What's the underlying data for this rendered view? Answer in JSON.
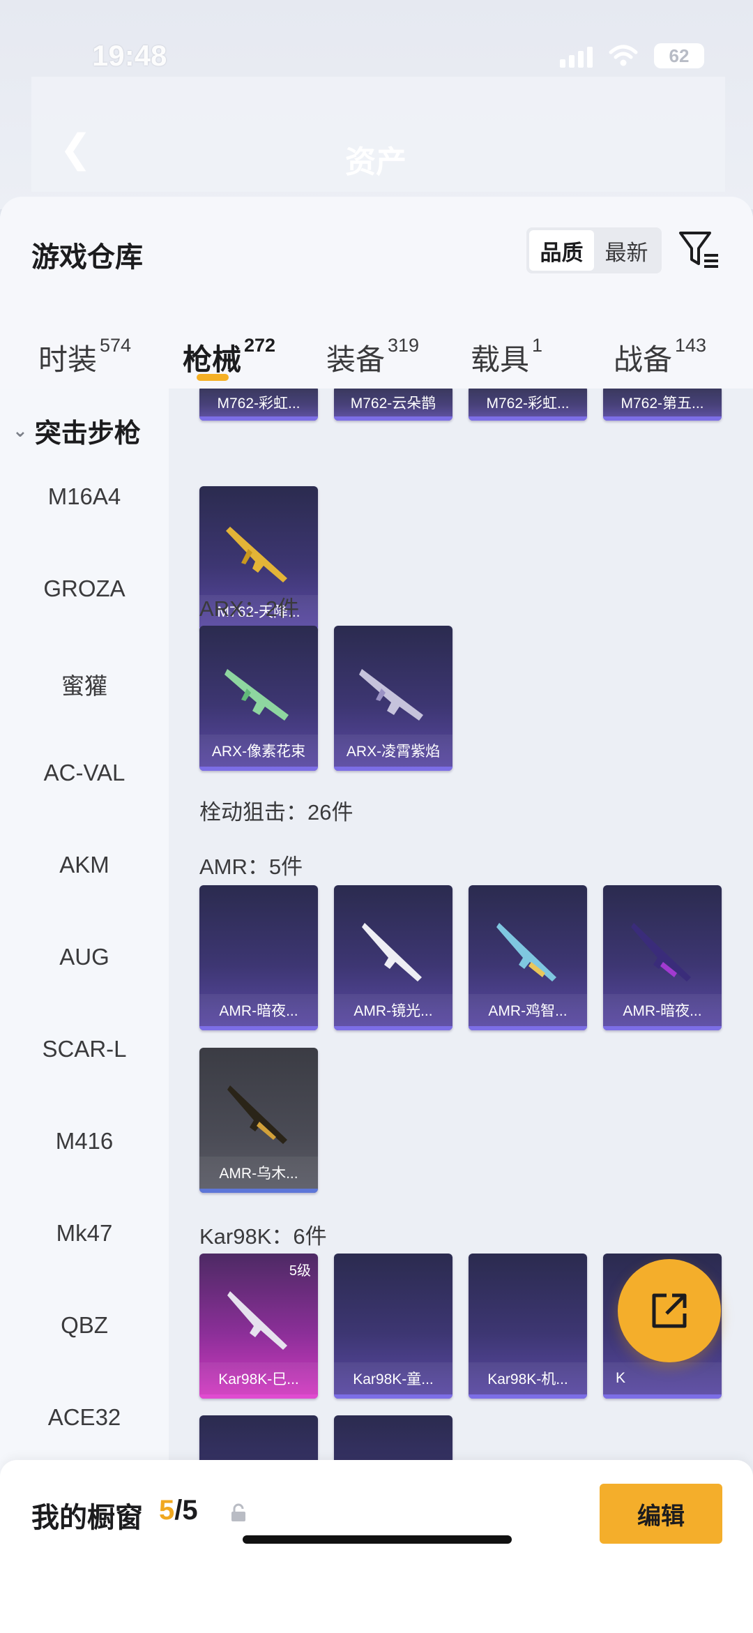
{
  "status": {
    "time": "19:48",
    "battery": "62"
  },
  "nav": {
    "back_icon": "chevron-left-icon",
    "title": "资产"
  },
  "header": {
    "title": "游戏仓库",
    "sort": {
      "options": [
        "品质",
        "最新"
      ],
      "selected": "品质"
    },
    "filter_icon": "filter-icon"
  },
  "tabs": [
    {
      "label": "时装",
      "count": "574"
    },
    {
      "label": "枪械",
      "count": "272",
      "active": true
    },
    {
      "label": "装备",
      "count": "319"
    },
    {
      "label": "载具",
      "count": "1"
    },
    {
      "label": "战备",
      "count": "143"
    }
  ],
  "sidebar": {
    "group": "突击步枪",
    "items": [
      "M16A4",
      "GROZA",
      "蜜獾",
      "AC-VAL",
      "AKM",
      "AUG",
      "SCAR-L",
      "M416",
      "Mk47",
      "QBZ",
      "ACE32"
    ]
  },
  "content": {
    "m762_top": [
      "M762-彩虹...",
      "M762-云朵鹊",
      "M762-彩虹...",
      "M762-第五..."
    ],
    "m762_extra": "M762-天降...",
    "arx_title": "ARX：2件",
    "arx": [
      "ARX-像素花束",
      "ARX-凌霄紫焰"
    ],
    "bolt_title": "栓动狙击：26件",
    "amr_title": "AMR：5件",
    "amr": [
      "AMR-暗夜...",
      "AMR-镜光...",
      "AMR-鸡智...",
      "AMR-暗夜...",
      "AMR-乌木..."
    ],
    "kar_title": "Kar98K：6件",
    "kar": [
      "Kar98K-巳...",
      "Kar98K-童...",
      "Kar98K-机...",
      "K"
    ],
    "kar_level": "5级"
  },
  "fab_icon": "share-external-icon",
  "bottom": {
    "title": "我的橱窗",
    "current": "5",
    "total": "/5",
    "lock_icon": "lock-icon",
    "edit_label": "编辑"
  },
  "colors": {
    "accent": "#f4ae2b",
    "card_purple": "#3d3672"
  }
}
